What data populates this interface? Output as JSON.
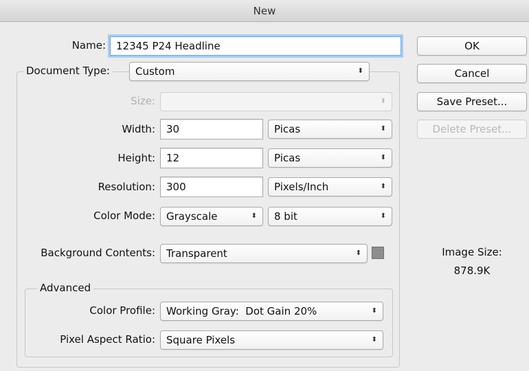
{
  "window": {
    "title": "New"
  },
  "name": {
    "label": "Name:",
    "value": "12345 P24 Headline"
  },
  "document_type": {
    "label": "Document Type:",
    "value": "Custom"
  },
  "size": {
    "label": "Size:",
    "value": ""
  },
  "width": {
    "label": "Width:",
    "value": "30",
    "unit": "Picas"
  },
  "height": {
    "label": "Height:",
    "value": "12",
    "unit": "Picas"
  },
  "resolution": {
    "label": "Resolution:",
    "value": "300",
    "unit": "Pixels/Inch"
  },
  "color_mode": {
    "label": "Color Mode:",
    "value": "Grayscale",
    "depth": "8 bit"
  },
  "background_contents": {
    "label": "Background Contents:",
    "value": "Transparent",
    "swatch_color": "#8e8e8e"
  },
  "advanced": {
    "label": "Advanced",
    "color_profile": {
      "label": "Color Profile:",
      "value": "Working Gray:  Dot Gain 20%"
    },
    "pixel_aspect_ratio": {
      "label": "Pixel Aspect Ratio:",
      "value": "Square Pixels"
    }
  },
  "buttons": {
    "ok": "OK",
    "cancel": "Cancel",
    "save_preset": "Save Preset...",
    "delete_preset": "Delete Preset..."
  },
  "image_size": {
    "label": "Image Size:",
    "value": "878.9K"
  },
  "icons": {
    "select_arrow": "⬍"
  }
}
